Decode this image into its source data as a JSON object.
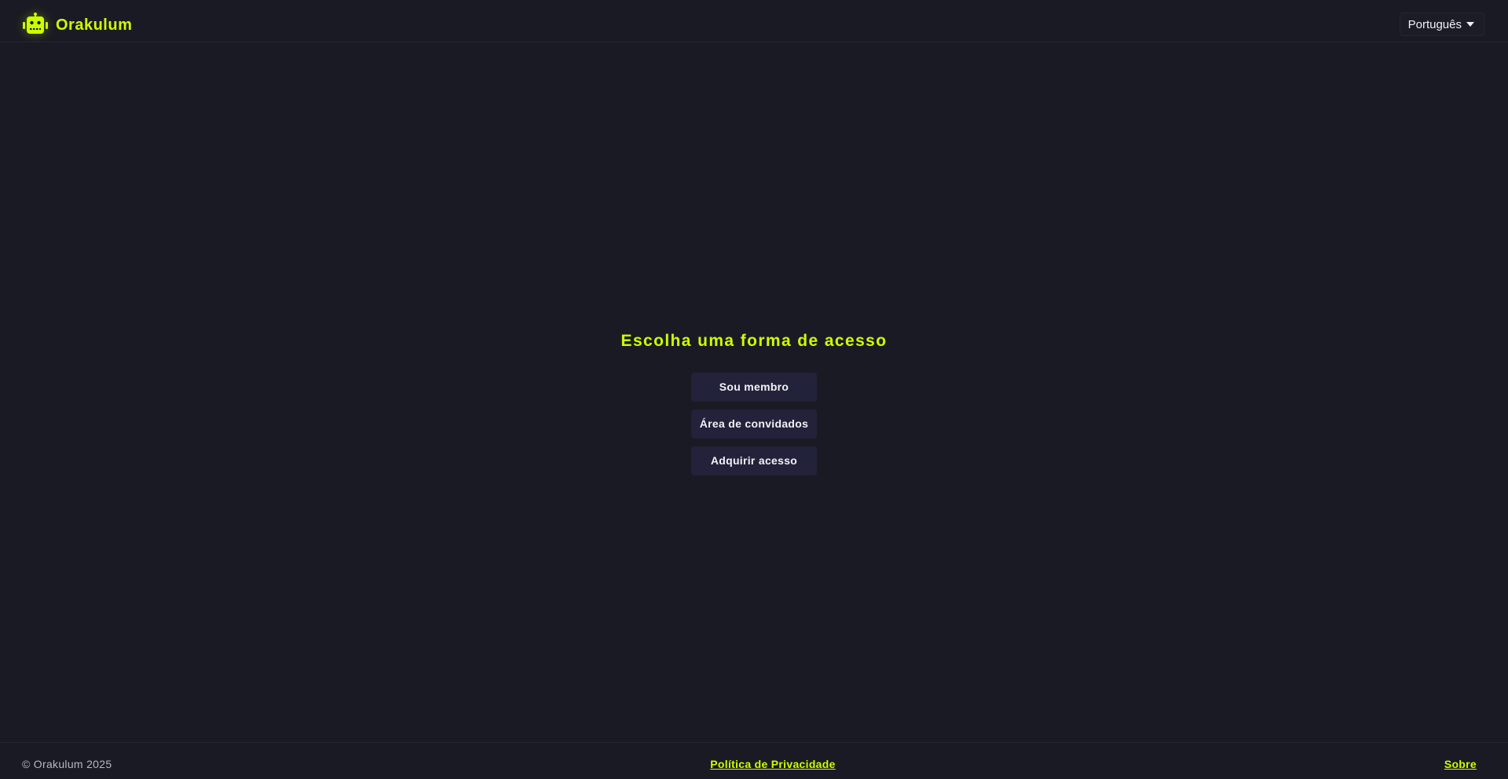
{
  "header": {
    "brand_name": "Orakulum",
    "language": {
      "selected": "Português"
    }
  },
  "main": {
    "heading": "Escolha uma forma de acesso",
    "buttons": [
      {
        "label": "Sou membro"
      },
      {
        "label": "Área de convidados"
      },
      {
        "label": "Adquirir acesso"
      }
    ]
  },
  "footer": {
    "copyright": "© Orakulum 2025",
    "privacy_link": "Política de Privacidade",
    "about_link": "Sobre"
  },
  "colors": {
    "background": "#1a1a24",
    "accent": "#ccff00",
    "button_bg": "#22223a",
    "text": "#f2f2f6"
  },
  "icons": {
    "brand": "robot-icon",
    "language_dropdown": "caret-down-icon"
  }
}
